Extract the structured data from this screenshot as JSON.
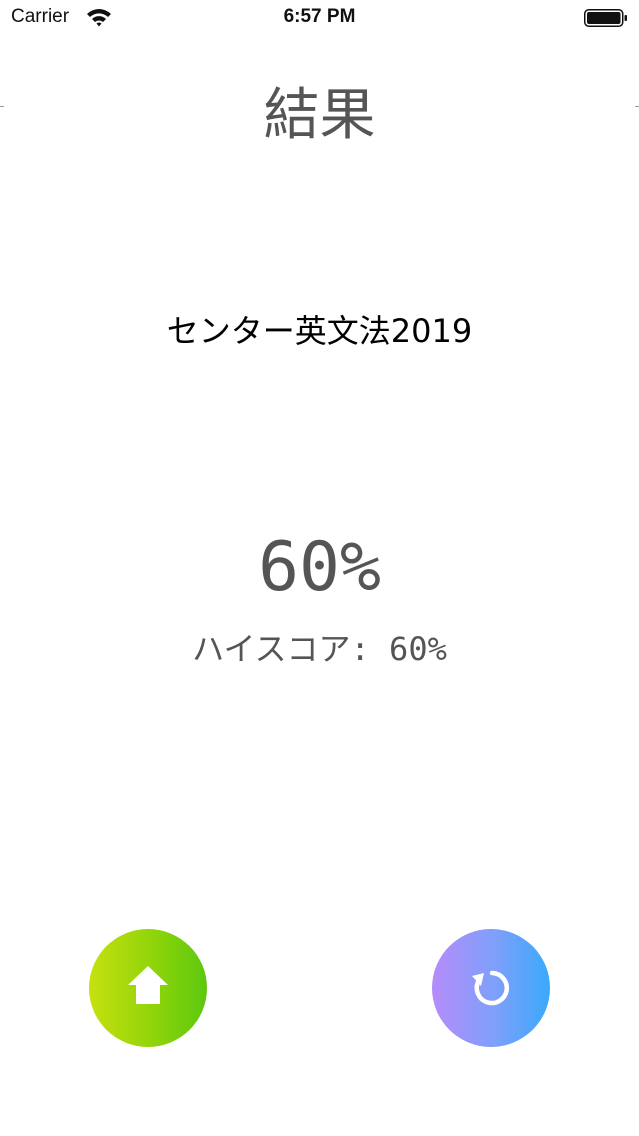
{
  "status_bar": {
    "carrier": "Carrier",
    "time": "6:57 PM",
    "wifi_icon": "wifi-icon",
    "battery_icon": "battery-full-icon"
  },
  "header": {
    "title": "結果"
  },
  "result": {
    "quiz_name": "センター英文法2019",
    "score": "60%",
    "high_score": "ハイスコア: 60%"
  },
  "actions": {
    "home_icon": "home-icon",
    "retry_icon": "retry-icon"
  },
  "colors": {
    "home_gradient": [
      "#c7e00f",
      "#5cc80f"
    ],
    "retry_gradient": [
      "#b58cfa",
      "#3aa9fb"
    ],
    "text_gray": "#555555"
  }
}
